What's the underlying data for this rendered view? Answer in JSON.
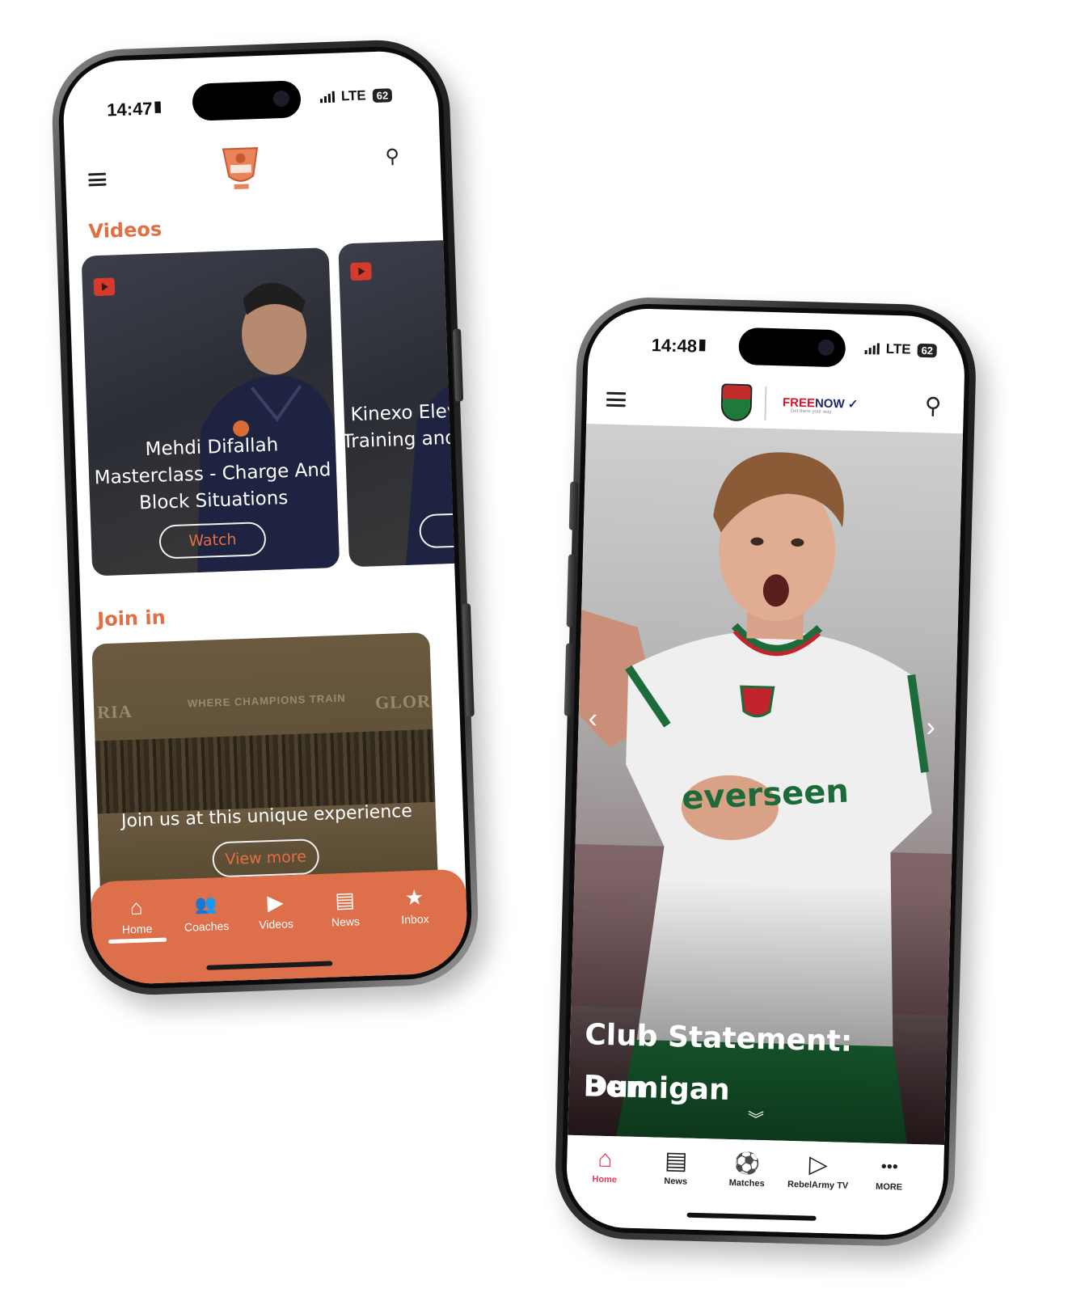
{
  "phone_left": {
    "status": {
      "time": "14:47",
      "network": "LTE",
      "battery": "62"
    },
    "sections": {
      "videos_title": "Videos",
      "join_title": "Join in"
    },
    "videos": [
      {
        "title": "Mehdi Difallah Masterclass - Charge And Block Situations",
        "button": "Watch"
      },
      {
        "title": "Kinexo Elevat Training and In-",
        "button": ""
      }
    ],
    "join_card": {
      "banner_left": "RIA",
      "banner_center": "WHERE CHAMPIONS TRAIN",
      "banner_right": "GLORI",
      "text": "Join us at this unique experience",
      "button": "View more"
    },
    "tabs": [
      {
        "label": "Home",
        "icon": "home-icon",
        "glyph": "⌂"
      },
      {
        "label": "Coaches",
        "icon": "coaches-icon",
        "glyph": "👥"
      },
      {
        "label": "Videos",
        "icon": "play-icon",
        "glyph": "▶"
      },
      {
        "label": "News",
        "icon": "news-icon",
        "glyph": "▤"
      },
      {
        "label": "Inbox",
        "icon": "star-icon",
        "glyph": "★"
      }
    ],
    "colors": {
      "accent": "#e26f43",
      "tabbar": "#dd6f4a"
    }
  },
  "phone_right": {
    "status": {
      "time": "14:48",
      "network": "LTE",
      "battery": "62"
    },
    "sponsor": {
      "free": "FREE",
      "now": "NOW",
      "tagline": "Get there your way"
    },
    "hero": {
      "title_line1": "Club Statement: Ben",
      "title_line2": "Dumigan",
      "shirt_sponsor": "everseen"
    },
    "tabs": [
      {
        "label": "Home",
        "icon": "home-icon",
        "glyph": "⌂"
      },
      {
        "label": "News",
        "icon": "news-icon",
        "glyph": "▤"
      },
      {
        "label": "Matches",
        "icon": "football-icon",
        "glyph": "⚽"
      },
      {
        "label": "RebelArmy TV",
        "icon": "play-circle-icon",
        "glyph": "▷"
      },
      {
        "label": "MORE",
        "icon": "more-icon",
        "glyph": "•••"
      }
    ],
    "colors": {
      "active_tab": "#e23b57",
      "crest_red": "#c22b2b",
      "crest_green": "#1d7a3a"
    }
  }
}
